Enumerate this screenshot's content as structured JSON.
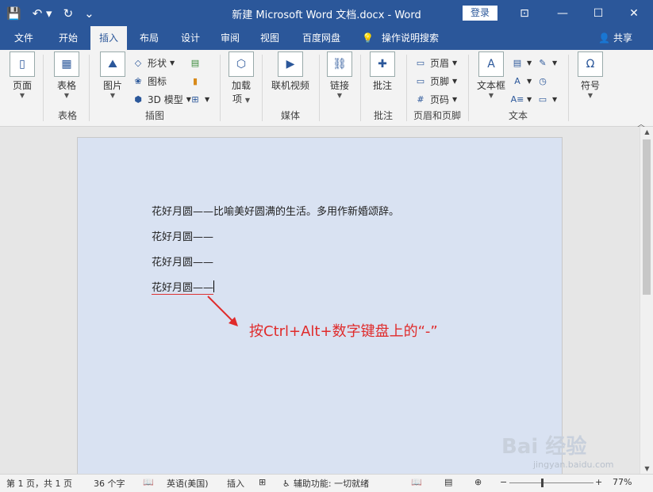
{
  "titlebar": {
    "title": "新建 Microsoft Word 文档.docx  -  Word",
    "login": "登录",
    "qat": {
      "save_icon": "💾",
      "undo_icon": "↶ ▾",
      "redo_icon": "↻",
      "customize_icon": "⌄"
    },
    "controls": {
      "ribbon_display": "⊡",
      "minimize": "—",
      "maximize": "☐",
      "close": "✕"
    }
  },
  "tabs": [
    "文件",
    "开始",
    "插入",
    "布局",
    "设计",
    "审阅",
    "视图",
    "百度网盘"
  ],
  "active_tab": "插入",
  "tellme": {
    "icon": "💡",
    "label": "操作说明搜索"
  },
  "share": {
    "icon": "👤",
    "label": "共享"
  },
  "ribbon": {
    "pages": {
      "label": "页面",
      "group": ""
    },
    "table": {
      "label": "表格",
      "group": "表格"
    },
    "illustrations": {
      "picture": "图片",
      "shapes": "形状",
      "icons": "图标",
      "model3d": "3D 模型",
      "group": "插图"
    },
    "addins": {
      "label_top": "加载",
      "label_bottom": "项"
    },
    "media": {
      "label": "联机视频",
      "group": "媒体"
    },
    "links": {
      "label": "链接",
      "group": ""
    },
    "comments": {
      "label": "批注",
      "group": "批注"
    },
    "header_footer": {
      "header": "页眉",
      "footer": "页脚",
      "page_number": "页码",
      "group": "页眉和页脚"
    },
    "text": {
      "textbox": "文本框",
      "group": "文本"
    },
    "symbols": {
      "label": "符号",
      "group": ""
    }
  },
  "document": {
    "lines": [
      "花好月圆——比喻美好圆满的生活。多用作新婚颂辞。",
      "花好月圆——",
      "花好月圆——",
      "花好月圆——"
    ],
    "annotation": "按Ctrl+Alt+数字键盘上的“-”"
  },
  "status": {
    "page": "第 1 页，共 1 页",
    "words": "36 个字",
    "language": "英语(美国)",
    "mode": "插入",
    "accessibility": "辅助功能: 一切就绪",
    "zoom": "77%"
  },
  "watermark": {
    "text": "Bai 经验",
    "sub": "jingyan.baidu.com"
  },
  "colors": {
    "accent": "#2b579a",
    "annotation": "#e02b2b",
    "page_bg": "#d9e2f2"
  }
}
